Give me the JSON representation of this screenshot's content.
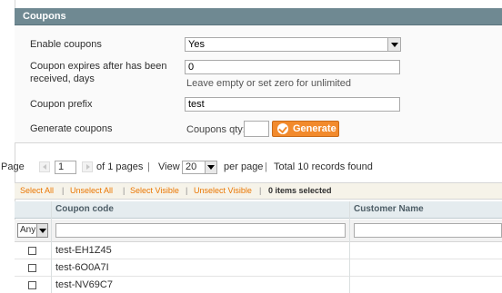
{
  "panel": {
    "title": "Coupons"
  },
  "form": {
    "enable_label": "Enable coupons",
    "enable_value": "Yes",
    "expires_label_line1": "Coupon expires after has been",
    "expires_label_line2": "received, days",
    "expires_value": "0",
    "expires_note": "Leave empty or set zero for unlimited",
    "prefix_label": "Coupon prefix",
    "prefix_value": "test",
    "generate_label": "Generate coupons",
    "qty_label": "Coupons qty:",
    "qty_value": "",
    "generate_button": "Generate"
  },
  "pager": {
    "page_label": "Page",
    "page_value": "1",
    "of_pages": "of 1 pages",
    "view_label": "View",
    "per_page_value": "20",
    "per_page_label": "per page",
    "total": "Total 10 records found",
    "separator": "|"
  },
  "massaction": {
    "select_all": "Select All",
    "unselect_all": "Unselect All",
    "select_visible": "Select Visible",
    "unselect_visible": "Unselect Visible",
    "selected_count": "0 items selected",
    "separator": "|"
  },
  "grid": {
    "columns": [
      "Coupon code",
      "Customer Name"
    ],
    "filter_any": "Any",
    "rows": [
      {
        "code": "test-EH1Z45"
      },
      {
        "code": "test-6O0A7I"
      },
      {
        "code": "test-NV69C7"
      }
    ]
  },
  "colors": {
    "header_bg": "#6f8992",
    "accent_orange": "#f28a2c",
    "link_orange": "#ea7601"
  }
}
